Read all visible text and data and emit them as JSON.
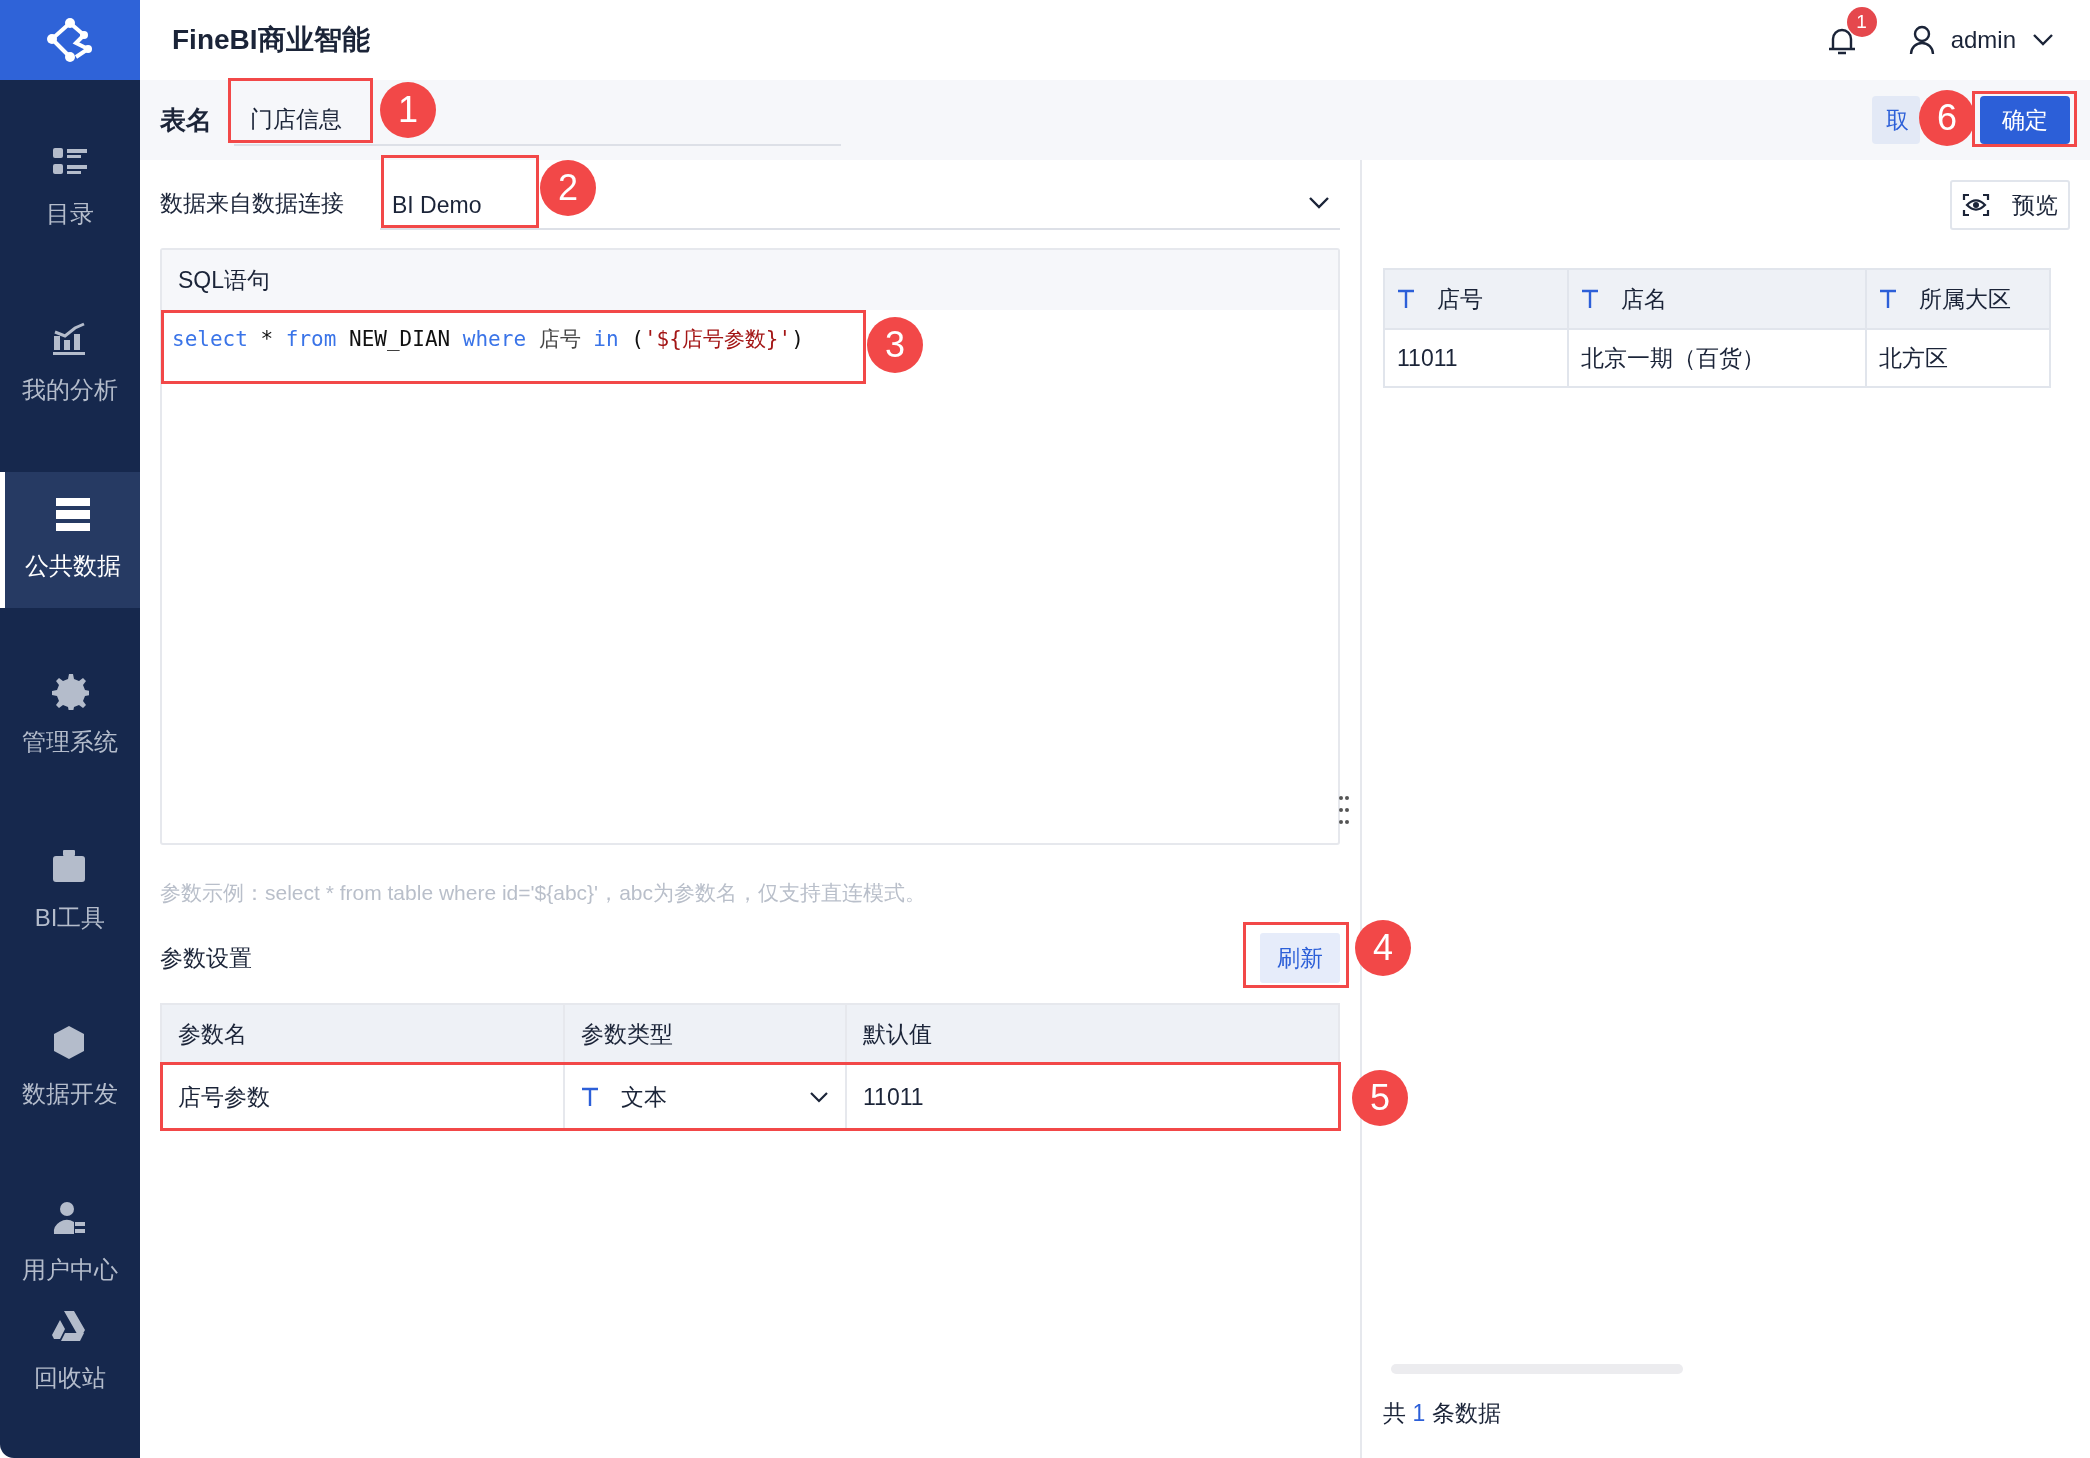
{
  "app": {
    "title": "FineBI商业智能"
  },
  "header": {
    "notification_count": "1",
    "user": "admin"
  },
  "sidebar": {
    "items": [
      {
        "label": "目录",
        "selected": false
      },
      {
        "label": "我的分析",
        "selected": false
      },
      {
        "label": "公共数据",
        "selected": true
      },
      {
        "label": "管理系统",
        "selected": false
      },
      {
        "label": "BI工具",
        "selected": false
      },
      {
        "label": "数据开发",
        "selected": false
      },
      {
        "label": "用户中心",
        "selected": false
      },
      {
        "label": "回收站",
        "selected": false
      }
    ]
  },
  "table_name": {
    "label": "表名",
    "value": "门店信息"
  },
  "actions": {
    "cancel": "取",
    "confirm": "确定"
  },
  "connection": {
    "label": "数据来自数据连接",
    "value": "BI Demo"
  },
  "sql": {
    "title": "SQL语句",
    "tokens": [
      {
        "text": "select",
        "kind": "keyword"
      },
      {
        "text": " * ",
        "kind": "plain"
      },
      {
        "text": "from",
        "kind": "keyword"
      },
      {
        "text": " NEW_DIAN ",
        "kind": "plain"
      },
      {
        "text": "where",
        "kind": "keyword"
      },
      {
        "text": " 店号 ",
        "kind": "field"
      },
      {
        "text": "in",
        "kind": "keyword"
      },
      {
        "text": " (",
        "kind": "plain"
      },
      {
        "text": "'${店号参数}'",
        "kind": "string"
      },
      {
        "text": ")",
        "kind": "plain"
      }
    ]
  },
  "hint": "参数示例：select * from table where id='${abc}'，abc为参数名，仅支持直连模式。",
  "params": {
    "title": "参数设置",
    "refresh": "刷新",
    "columns": [
      "参数名",
      "参数类型",
      "默认值"
    ],
    "rows": [
      {
        "name": "店号参数",
        "type": "文本",
        "default": "11011"
      }
    ]
  },
  "preview": {
    "button": "预览",
    "columns": [
      "店号",
      "店名",
      "所属大区"
    ],
    "rows": [
      [
        "11011",
        "北京一期（百货）",
        "北方区"
      ]
    ],
    "footer": {
      "prefix": "共",
      "count": "1",
      "suffix": "条数据"
    }
  },
  "annotations": [
    {
      "number": "1"
    },
    {
      "number": "2"
    },
    {
      "number": "3"
    },
    {
      "number": "4"
    },
    {
      "number": "5"
    },
    {
      "number": "6"
    }
  ]
}
